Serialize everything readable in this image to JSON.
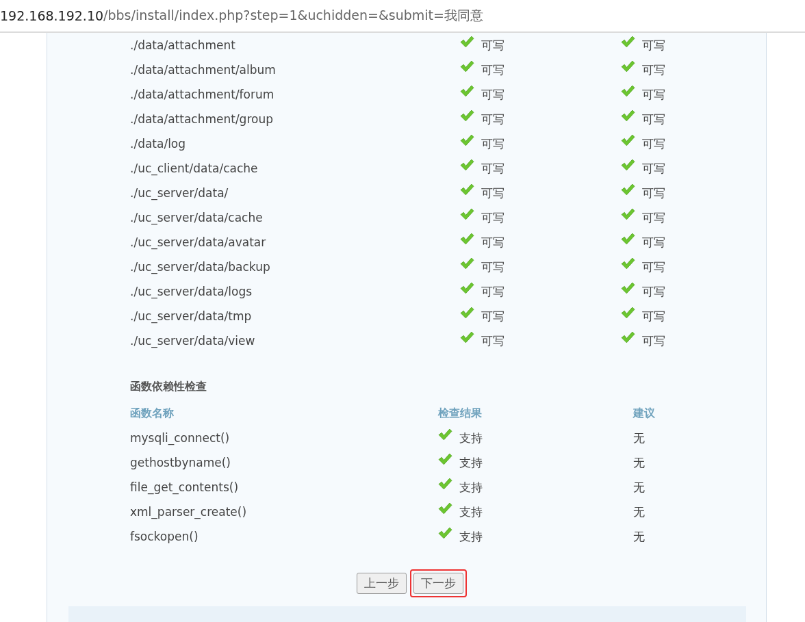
{
  "address_bar": {
    "host": "192.168.192.10",
    "path": "/bbs/install/index.php?step=1&uchidden=&submit=我同意"
  },
  "directory_rows": [
    {
      "path": "./data/attachment",
      "column_2": {
        "ok": true,
        "text": "可写"
      },
      "column_3": {
        "ok": true,
        "text": "可写"
      }
    },
    {
      "path": "./data/attachment/album",
      "column_2": {
        "ok": true,
        "text": "可写"
      },
      "column_3": {
        "ok": true,
        "text": "可写"
      }
    },
    {
      "path": "./data/attachment/forum",
      "column_2": {
        "ok": true,
        "text": "可写"
      },
      "column_3": {
        "ok": true,
        "text": "可写"
      }
    },
    {
      "path": "./data/attachment/group",
      "column_2": {
        "ok": true,
        "text": "可写"
      },
      "column_3": {
        "ok": true,
        "text": "可写"
      }
    },
    {
      "path": "./data/log",
      "column_2": {
        "ok": true,
        "text": "可写"
      },
      "column_3": {
        "ok": true,
        "text": "可写"
      }
    },
    {
      "path": "./uc_client/data/cache",
      "column_2": {
        "ok": true,
        "text": "可写"
      },
      "column_3": {
        "ok": true,
        "text": "可写"
      }
    },
    {
      "path": "./uc_server/data/",
      "column_2": {
        "ok": true,
        "text": "可写"
      },
      "column_3": {
        "ok": true,
        "text": "可写"
      }
    },
    {
      "path": "./uc_server/data/cache",
      "column_2": {
        "ok": true,
        "text": "可写"
      },
      "column_3": {
        "ok": true,
        "text": "可写"
      }
    },
    {
      "path": "./uc_server/data/avatar",
      "column_2": {
        "ok": true,
        "text": "可写"
      },
      "column_3": {
        "ok": true,
        "text": "可写"
      }
    },
    {
      "path": "./uc_server/data/backup",
      "column_2": {
        "ok": true,
        "text": "可写"
      },
      "column_3": {
        "ok": true,
        "text": "可写"
      }
    },
    {
      "path": "./uc_server/data/logs",
      "column_2": {
        "ok": true,
        "text": "可写"
      },
      "column_3": {
        "ok": true,
        "text": "可写"
      }
    },
    {
      "path": "./uc_server/data/tmp",
      "column_2": {
        "ok": true,
        "text": "可写"
      },
      "column_3": {
        "ok": true,
        "text": "可写"
      }
    },
    {
      "path": "./uc_server/data/view",
      "column_2": {
        "ok": true,
        "text": "可写"
      },
      "column_3": {
        "ok": true,
        "text": "可写"
      }
    }
  ],
  "function_check": {
    "title": "函数依赖性检查",
    "columns": [
      "函数名称",
      "检查结果",
      "建议"
    ],
    "rows": [
      {
        "name": "mysqli_connect()",
        "ok": true,
        "result": "支持",
        "advice": "无"
      },
      {
        "name": "gethostbyname()",
        "ok": true,
        "result": "支持",
        "advice": "无"
      },
      {
        "name": "file_get_contents()",
        "ok": true,
        "result": "支持",
        "advice": "无"
      },
      {
        "name": "xml_parser_create()",
        "ok": true,
        "result": "支持",
        "advice": "无"
      },
      {
        "name": "fsockopen()",
        "ok": true,
        "result": "支持",
        "advice": "无"
      }
    ]
  },
  "buttons": [
    {
      "label": "上一步",
      "highlighted": false
    },
    {
      "label": "下一步",
      "highlighted": true
    }
  ]
}
